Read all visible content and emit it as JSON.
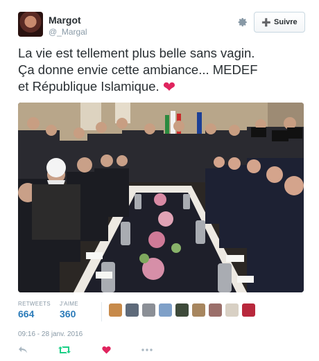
{
  "user": {
    "name": "Margot",
    "handle": "@_Margal",
    "avatar_icon": "profile-photo"
  },
  "follow_button": {
    "label": "Suivre",
    "icon": "add-user-icon"
  },
  "settings_icon": "gear-icon",
  "tweet": {
    "line1": "La vie est tellement plus belle sans vagin.",
    "line2": "Ça donne envie cette ambiance... MEDEF",
    "line3": "et République Islamique.",
    "emoji": "❤"
  },
  "stats": {
    "retweets_label": "RETWEETS",
    "retweets_value": "664",
    "likes_label": "J'AIME",
    "likes_value": "360"
  },
  "timestamp": "09:16 - 28 janv. 2016",
  "actions": {
    "reply_icon": "reply-icon",
    "retweet_icon": "retweet-icon",
    "like_icon": "heart-icon",
    "more_icon": "more-icon"
  },
  "colors": {
    "link_blue": "#2b7bb9",
    "heart_red": "#e0245e",
    "muted": "#8899a6",
    "retweet_green": "#19cf86"
  }
}
